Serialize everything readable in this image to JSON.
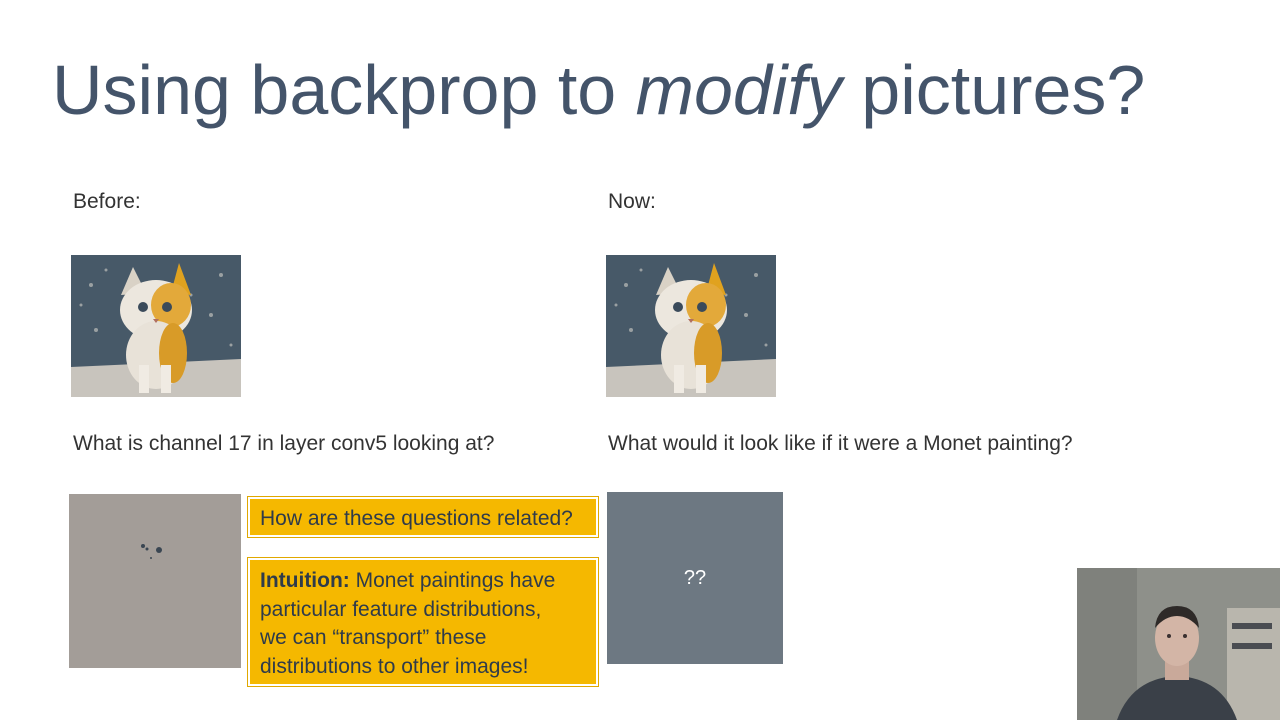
{
  "slide": {
    "title_prefix": "Using backprop to ",
    "title_emphasis": "modify",
    "title_suffix": " pictures?",
    "before_label": "Before:",
    "now_label": "Now:",
    "before_caption": "What is channel 17 in layer conv5 looking at?",
    "now_caption": "What would it look like if it were a Monet painting?",
    "placeholder_text": "??",
    "question_callout": "How are these questions related?",
    "intuition_heading": "Intuition:",
    "intuition_body": " Monet paintings have\nparticular feature distributions,\nwe can “transport” these\ndistributions to other images!"
  },
  "colors": {
    "title": "#44546a",
    "callout_fill": "#f5b800",
    "callout_text": "#2f3b4a",
    "feature_map_bg": "#a39d98",
    "monet_placeholder_bg": "#6d7882"
  },
  "icons": {
    "kitten_image": "kitten-photo",
    "feature_map_image": "activation-map",
    "webcam": "presenter-video"
  }
}
